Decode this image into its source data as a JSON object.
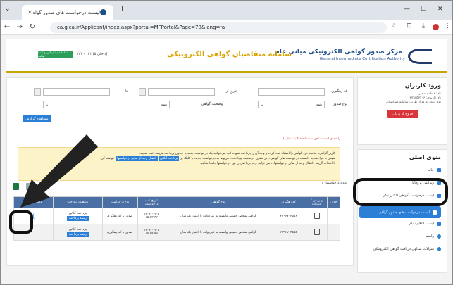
{
  "browser": {
    "tab_title": "لیست درخواست های صدور گواه",
    "url": "ca.gica.ir/Applicant/index.aspx?portal=MFPortal&Page=78&lang=fa"
  },
  "header": {
    "logo_fa": "مرکز صدور گواهی الکترونیکی میانی عام",
    "logo_en": "General Intermediate Certification Authority",
    "portal_title": "سامانه متقاضیان گواهی الکترونیکی",
    "support_label": "سامانه پشتیبانی و ثبت تیکت",
    "phone": "(داخلی ۵) ۰۲۱ - ۱۲۴"
  },
  "login": {
    "title": "ورود کاربران",
    "name": "نام: فاطمه محبی",
    "username": "نام کاربری: ۰۲۷۹۸۵۷۷۰۶",
    "login_type": "نوع ورود: ورود از طریق سامانه متقاضیان",
    "logout": "خروج از پرتال"
  },
  "menu": {
    "title": "منوی اصلی",
    "items": [
      "خانه",
      "ویرایش پروفایل",
      "لیست درخواست گواهی الکترونیکی",
      "لیست درخواست های صدور گواهی",
      "لیست اعلام تمام",
      "راهنما",
      "سوالات متداول دریافت گواهی الکترونیکی"
    ]
  },
  "filters": {
    "tracking_code": "کد رهگیری",
    "date_from": "تاریخ از",
    "to": "تا",
    "issue_type": "نوع صدور",
    "cert_status": "وضعیت گواهی",
    "all": "همه",
    "search": "مشاهده گزارش"
  },
  "guide": "راهنمای لیست: (جهت مشاهده کلیک نمایید)",
  "notice": {
    "line1": "کاربر گرامی، چنانچه نوع گواهی را اشتباه ثبت کرده و وجه آن را پرداخت نموده اید، می توانید یک درخواست جدید با «بدون پرداخت هزینه» ثبت نمایید.",
    "line2": "سپس با مراجعه به «لیست درخواست های گواهی» در ستون «وضعیت پرداخت» مربوط به درخواست جدید، با کلیک بر",
    "online_btn": "پرداخت آنلاین",
    "transfer_btn": "انتقال وجه از سایر درخواستها",
    "line3": "با انتخاب گزینه «انتقال وجه از سایر درخواستها»، می توانید وجه پرداختی را بین درخواستها جابجا نمایید.",
    "suffix": "خواهید کرد"
  },
  "table": {
    "count": "تعداد درخواستها: ۲",
    "headers": [
      "حذف",
      "ویرایش / جزئیات",
      "کد رهگیری",
      "نوع گواهی",
      "تاریخ ثبت درخواست",
      "نوع درخواست",
      "وضعیت پرداخت",
      "دانلود گواهی"
    ],
    "rows": [
      {
        "code": "۲۳۹۶۷۰۴۵۵۶",
        "type": "گواهی شخص حقیقی وابسته به غیردولت با اعتبار یک سال",
        "date": "۱۴۰۲/۰۴/۰۵",
        "time": "۱۵:۳۳:۳۲",
        "req": "صدور با کد رهگیری",
        "pay": "پرداخت آنلاین",
        "receipt": "رسید پرداخت"
      },
      {
        "code": "۲۳۹۶۷۰۴۵۵۵",
        "type": "گواهی شخص حقیقی وابسته به غیردولت با اعتبار یک سال",
        "date": "۱۴۰۲/۰۴/۰۵",
        "time": "۱۲:۲۴:۴۷",
        "req": "صدور با کد رهگیری",
        "pay": "پرداخت آنلاین",
        "receipt": "رسید پرداخت"
      }
    ]
  }
}
